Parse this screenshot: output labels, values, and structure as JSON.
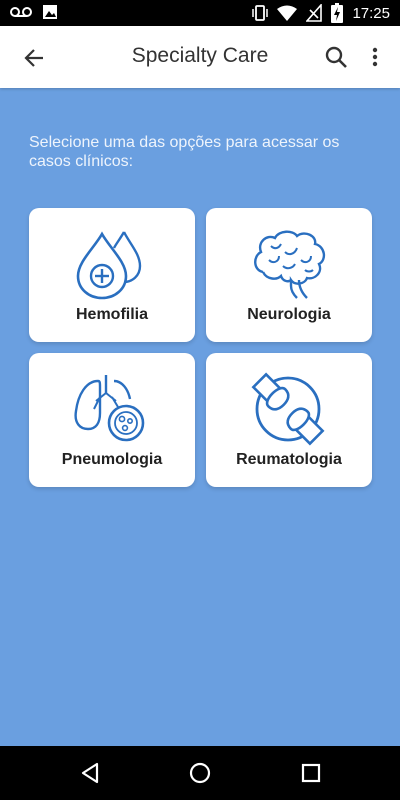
{
  "status_bar": {
    "time": "17:25",
    "icons": [
      "voicemail-icon",
      "image-icon",
      "vibrate-icon",
      "wifi-icon",
      "no-sim-icon",
      "battery-charging-icon"
    ]
  },
  "app_bar": {
    "title": "Specialty Care",
    "back_icon": "arrow-back-icon",
    "search_icon": "search-icon",
    "more_icon": "more-vert-icon"
  },
  "main": {
    "instruction": "Selecione uma das opções para acessar os casos clínicos:",
    "cards": [
      {
        "label": "Hemofilia",
        "icon": "blood-drops-icon"
      },
      {
        "label": "Neurologia",
        "icon": "brain-icon"
      },
      {
        "label": "Pneumologia",
        "icon": "lungs-icon"
      },
      {
        "label": "Reumatologia",
        "icon": "joint-icon"
      }
    ]
  },
  "nav_bar": {
    "icons": [
      "back-triangle-icon",
      "home-circle-icon",
      "recents-square-icon"
    ]
  },
  "colors": {
    "background": "#6a9fe0",
    "icon_blue": "#2a6fc0",
    "card": "#ffffff"
  }
}
